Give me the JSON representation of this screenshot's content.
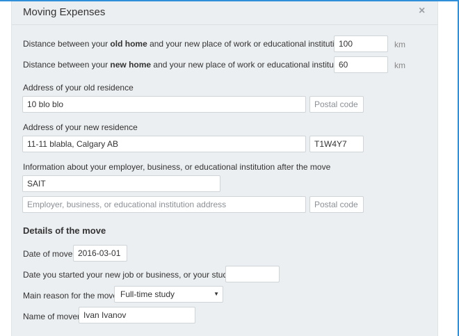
{
  "modal": {
    "title": "Moving Expenses",
    "close_icon": "close-icon",
    "close_glyph": "×"
  },
  "distance": {
    "old_home": {
      "label_before": "Distance between your ",
      "label_bold": "old home",
      "label_after": " and your new place of work or educational institution",
      "value": "100",
      "unit": "km"
    },
    "new_home": {
      "label_before": "Distance between your ",
      "label_bold": "new home",
      "label_after": " and your new place of work or educational institution",
      "value": "60",
      "unit": "km"
    }
  },
  "old_residence": {
    "label": "Address of your old residence",
    "address": "10 blo blo",
    "postal_placeholder": "Postal code",
    "postal": ""
  },
  "new_residence": {
    "label": "Address of your new residence",
    "address": "11-11 blabla, Calgary AB",
    "postal": "T1W4Y7"
  },
  "employer": {
    "label": "Information about your employer, business, or educational institution after the move",
    "name": "SAIT",
    "address_placeholder": "Employer, business, or educational institution address",
    "postal_placeholder": "Postal code"
  },
  "details": {
    "heading": "Details of the move",
    "date_of_move_label": "Date of move",
    "date_of_move": "2016-03-01",
    "start_date_label": "Date you started your new job or business, or your studies",
    "start_date": "",
    "reason_label": "Main reason for the move",
    "reason_value": "Full-time study",
    "reason_caret": "▼",
    "mover_label": "Name of mover",
    "mover_name": "Ivan Ivanov"
  }
}
